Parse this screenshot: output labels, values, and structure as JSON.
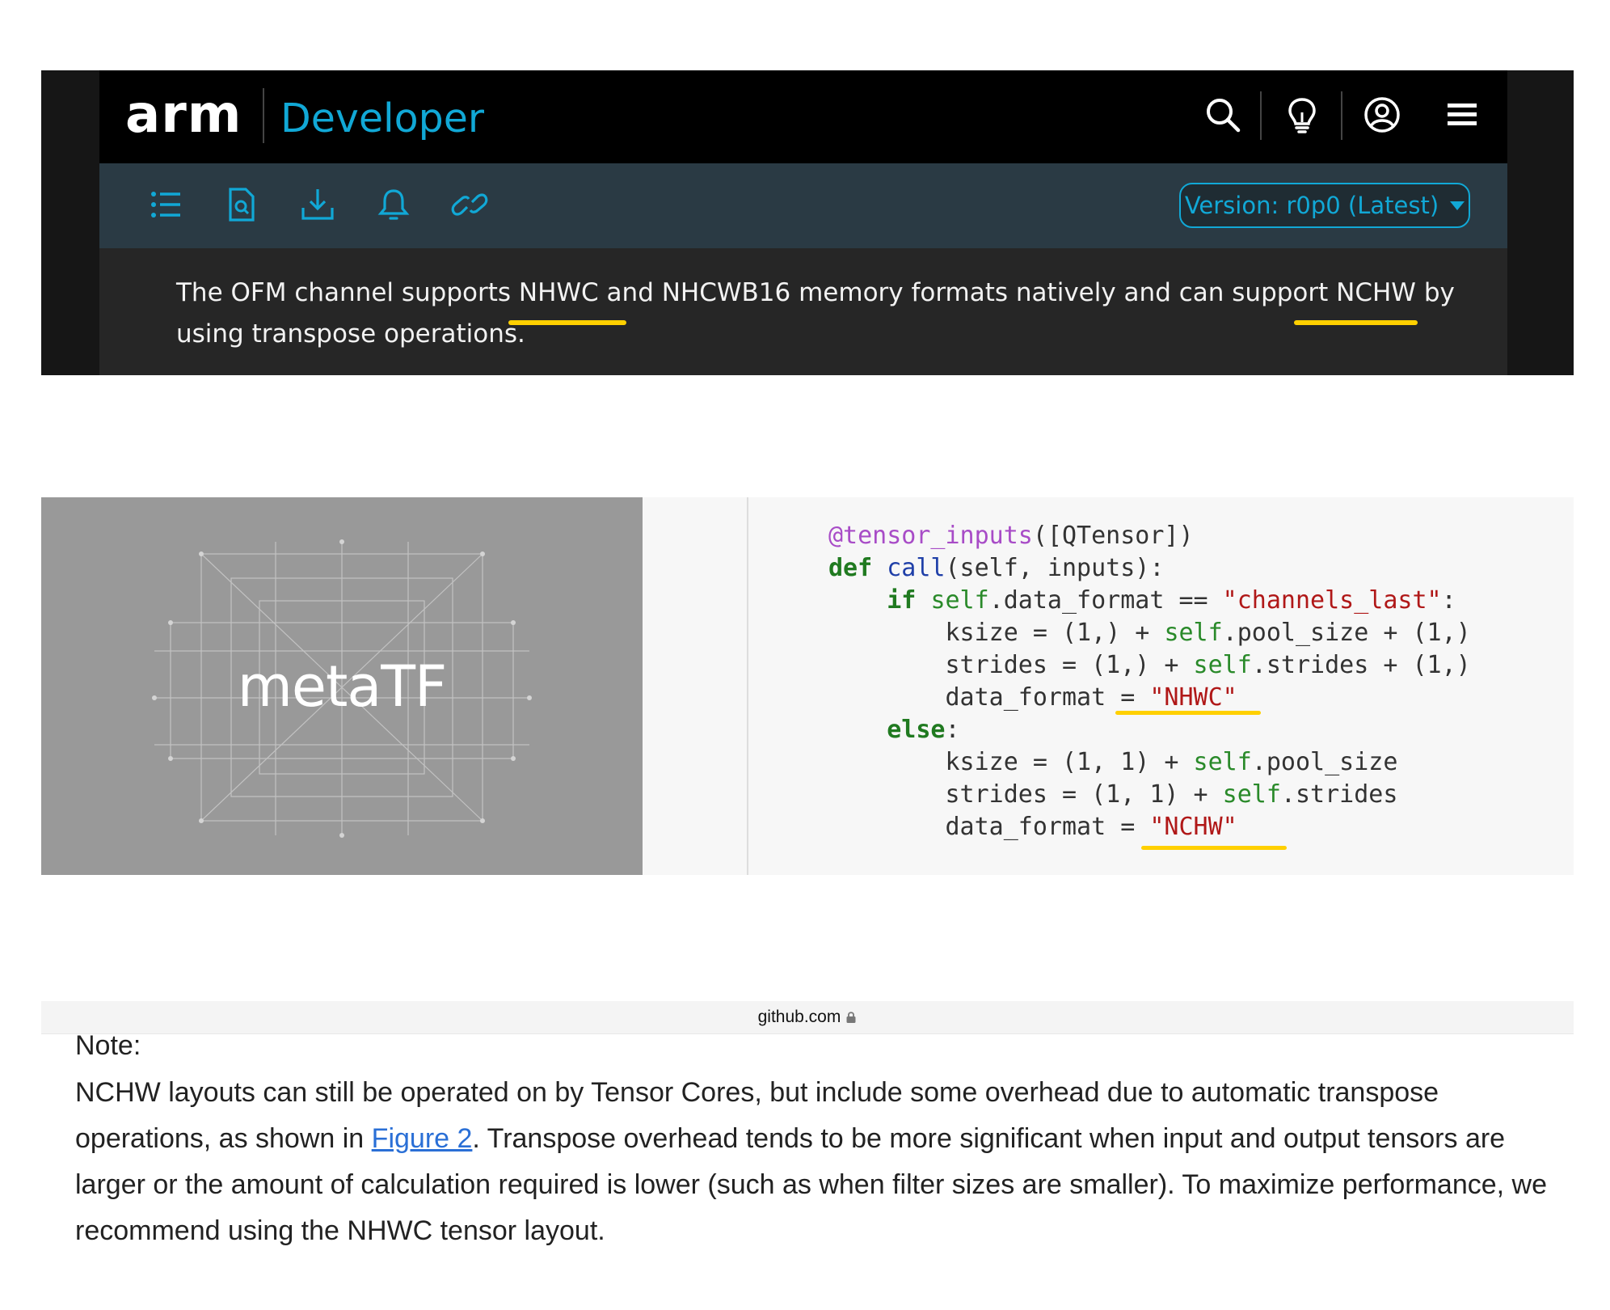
{
  "arm": {
    "logo": "arm",
    "product": "Developer",
    "header_icons": [
      "search-icon",
      "lightbulb-icon",
      "user-account-icon",
      "menu-icon"
    ],
    "toolbar_icons": [
      "list-icon",
      "document-search-icon",
      "download-icon",
      "bell-icon",
      "link-icon"
    ],
    "version": "Version: r0p0 (Latest)",
    "text_1": "The OFM channel supports ",
    "text_nhwc": "NHWC",
    "text_2": " and NHCWB16 memory formats natively and can support ",
    "text_nchw": "NCHW",
    "text_3": " by using transpose operations.",
    "accent_color": "#11a8d6",
    "highlight_color": "#ffd000"
  },
  "metatf": {
    "logo_text": "metaTF"
  },
  "code": {
    "docstring_tail": "\"\"\"",
    "decorator": "@tensor_inputs",
    "decorator_args": "([QTensor])",
    "def_kw": "def",
    "fn_name": "call",
    "fn_args": "(self, inputs):",
    "if_kw": "if",
    "if_cond_a": "self",
    "if_cond_b": ".data_format == ",
    "channels_last": "\"channels_last\"",
    "colon": ":",
    "ksize_a": "ksize = (1,) + ",
    "ksize_self": "self",
    "ksize_b": ".pool_size + (1,)",
    "strides_a": "strides = (1,) + ",
    "strides_self": "self",
    "strides_b": ".strides + (1,)",
    "df_a": "data_format = ",
    "nhwc": "\"NHWC\"",
    "else_kw": "else",
    "ksize2_a": "ksize = (1, 1) + ",
    "ksize2_self": "self",
    "ksize2_b": ".pool_size",
    "strides2_a": "strides = (1, 1) + ",
    "strides2_self": "self",
    "strides2_b": ".strides",
    "df2_a": "data_format = ",
    "nchw": "\"NCHW\""
  },
  "github": {
    "domain": "github.com",
    "lock_icon": "lock-icon"
  },
  "note": {
    "title": "Note:",
    "body_1": "NCHW layouts can still be operated on by Tensor Cores, but include some overhead due to automatic transpose operations, as shown in ",
    "link": "Figure 2",
    "body_2": ". Transpose overhead tends to be more significant when input and output tensors are larger or the amount of calculation required is lower (such as when filter sizes are smaller). To maximize performance, we recommend using the NHWC tensor layout.",
    "link_color": "#2a6fd6"
  }
}
